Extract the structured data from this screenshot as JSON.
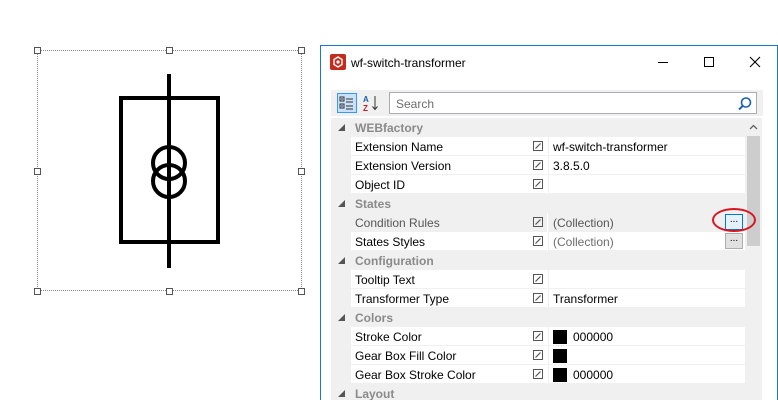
{
  "window": {
    "title": "wf-switch-transformer",
    "buttons": {
      "minimize": "minimize-icon",
      "maximize": "maximize-icon",
      "close": "close-icon"
    }
  },
  "toolbar": {
    "categorized_icon": "categorized-view-icon",
    "alphabetical_icon": "alphabetical-sort-icon",
    "search_placeholder": "Search",
    "search_icon": "magnifier-icon"
  },
  "grid": {
    "categories": [
      {
        "label": "WEBfactory",
        "properties": [
          {
            "name": "Extension Name",
            "value": "wf-switch-transformer"
          },
          {
            "name": "Extension Version",
            "value": "3.8.5.0"
          },
          {
            "name": "Object ID",
            "value": ""
          }
        ]
      },
      {
        "label": "States",
        "properties": [
          {
            "name": "Condition Rules",
            "value": "(Collection)",
            "button": "..."
          },
          {
            "name": "States Styles",
            "value": "(Collection)",
            "button": "..."
          }
        ]
      },
      {
        "label": "Configuration",
        "properties": [
          {
            "name": "Tooltip Text",
            "value": ""
          },
          {
            "name": "Transformer Type",
            "value": "Transformer"
          }
        ]
      },
      {
        "label": "Colors",
        "properties": [
          {
            "name": "Stroke Color",
            "value": "000000",
            "swatch": "#000000"
          },
          {
            "name": "Gear Box Fill Color",
            "value": "",
            "swatch": "#000000"
          },
          {
            "name": "Gear Box Stroke Color",
            "value": "000000",
            "swatch": "#000000"
          }
        ]
      },
      {
        "label": "Layout",
        "properties": []
      }
    ]
  },
  "colors": {
    "window_border": "#1979ca",
    "category_bg": "#f0f0f0",
    "highlight_ring": "#d8141e",
    "app_icon": "#c42b1c"
  }
}
